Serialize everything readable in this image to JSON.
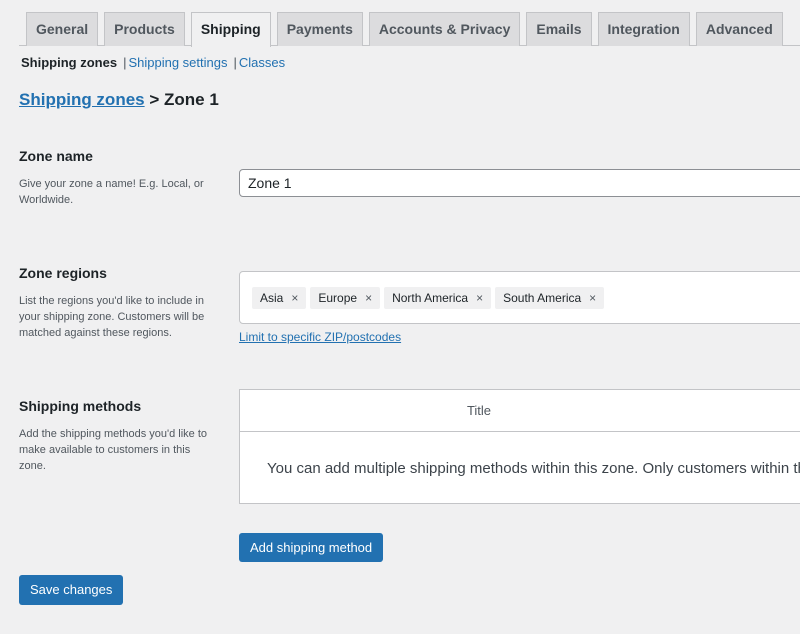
{
  "tabs": [
    "General",
    "Products",
    "Shipping",
    "Payments",
    "Accounts & Privacy",
    "Emails",
    "Integration",
    "Advanced"
  ],
  "active_tab": "Shipping",
  "subnav": {
    "current": "Shipping zones",
    "links": [
      "Shipping settings",
      "Classes"
    ]
  },
  "breadcrumb": {
    "link": "Shipping zones",
    "separator": ">",
    "current": "Zone 1"
  },
  "zone_name": {
    "label": "Zone name",
    "description": "Give your zone a name! E.g. Local, or Worldwide.",
    "value": "Zone 1"
  },
  "zone_regions": {
    "label": "Zone regions",
    "description": "List the regions you'd like to include in your shipping zone. Customers will be matched against these regions.",
    "regions": [
      "Asia",
      "Europe",
      "North America",
      "South America"
    ],
    "remove_glyph": "×",
    "limit_link": "Limit to specific ZIP/postcodes"
  },
  "shipping_methods": {
    "label": "Shipping methods",
    "description": "Add the shipping methods you'd like to make available to customers in this zone.",
    "column_title": "Title",
    "empty_text": "You can add multiple shipping methods within this zone. Only customers within the zone will see them.",
    "add_button": "Add shipping method"
  },
  "save_button": "Save changes"
}
